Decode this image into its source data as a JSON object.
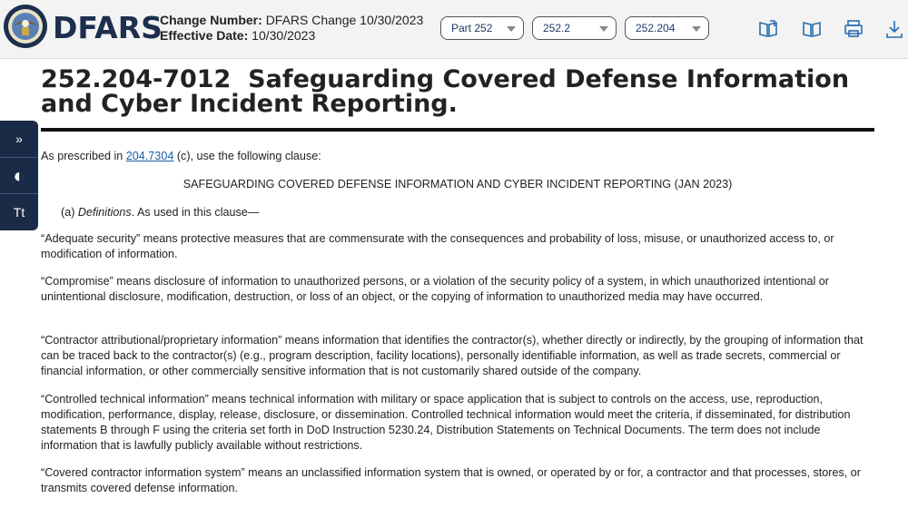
{
  "header": {
    "brand": "DFARS",
    "change_label": "Change Number:",
    "change_value": "DFARS Change 10/30/2023",
    "effective_label": "Effective Date:",
    "effective_value": "10/30/2023",
    "selects": [
      "Part 252",
      "252.2",
      "252.204"
    ],
    "tools": [
      "book-open-icon",
      "book-icon",
      "print-icon",
      "download-icon"
    ]
  },
  "sidebar": {
    "expand": "»",
    "contrast": "◐",
    "text_size": "Tt"
  },
  "doc": {
    "title_number": "252.204-7012",
    "title_text": "Safeguarding Covered Defense Information and Cyber Incident Reporting.",
    "prescribed_pre": "As prescribed in ",
    "prescribed_link": "204.7304",
    "prescribed_post": " (c), use the following clause:",
    "clause_heading": "SAFEGUARDING COVERED DEFENSE INFORMATION AND CYBER INCIDENT REPORTING (JAN 2023)",
    "defs_label": "(a) ",
    "defs_italic": "Definitions",
    "defs_rest": ". As used in this clause—",
    "paragraphs": [
      "“Adequate security” means protective measures that are commensurate with the consequences and probability of loss, misuse, or unauthorized access to, or modification of information.",
      "“Compromise” means disclosure of information to unauthorized persons, or a violation of the security policy of a system, in which unauthorized intentional or unintentional disclosure, modification, destruction, or loss of an object, or the copying of information to unauthorized media may have occurred.",
      "“Contractor attributional/proprietary information” means information that identifies the contractor(s), whether directly or indirectly, by the grouping of information that can be traced back to the contractor(s) (e.g., program description, facility locations), personally identifiable information, as well as trade secrets, commercial or financial information, or other commercially sensitive information that is not customarily shared outside of the company.",
      "“Controlled technical information” means technical information with military or space application that is subject to controls on the access, use, reproduction, modification, performance, display, release, disclosure, or dissemination. Controlled technical information would meet the criteria, if disseminated, for distribution statements B through F using the criteria set forth in DoD Instruction 5230.24, Distribution Statements on Technical Documents. The term does not include information that is lawfully publicly available without restrictions.",
      "“Covered contractor information system” means an unclassified information system that is owned, or operated by or for, a contractor and that processes, stores, or transmits covered defense information."
    ]
  }
}
